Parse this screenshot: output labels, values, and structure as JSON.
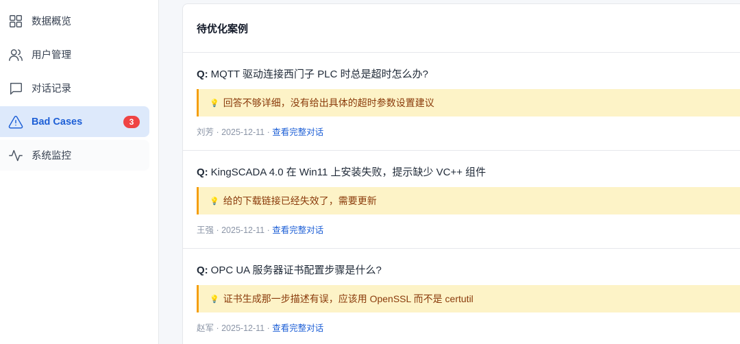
{
  "sidebar": {
    "items": [
      {
        "label": "数据概览",
        "icon": "grid-icon"
      },
      {
        "label": "用户管理",
        "icon": "users-icon"
      },
      {
        "label": "对话记录",
        "icon": "message-icon"
      },
      {
        "label": "Bad Cases",
        "icon": "alert-triangle-icon",
        "badge": "3",
        "active": true
      },
      {
        "label": "系统监控",
        "icon": "activity-icon"
      }
    ]
  },
  "main": {
    "card_title": "待优化案例",
    "cases": [
      {
        "q_prefix": "Q:",
        "question": "MQTT 驱动连接西门子 PLC 时总是超时怎么办?",
        "bulb": "💡",
        "note": "回答不够详细，没有给出具体的超时参数设置建议",
        "meta_prefix": "刘芳 · 2025-12-11 · ",
        "link": "查看完整对话"
      },
      {
        "q_prefix": "Q:",
        "question": "KingSCADA 4.0 在 Win11 上安装失败，提示缺少 VC++ 组件",
        "bulb": "💡",
        "note": "给的下载链接已经失效了，需要更新",
        "meta_prefix": "王强 · 2025-12-11 · ",
        "link": "查看完整对话"
      },
      {
        "q_prefix": "Q:",
        "question": "OPC UA 服务器证书配置步骤是什么?",
        "bulb": "💡",
        "note": "证书生成那一步描述有误，应该用 OpenSSL 而不是 certutil",
        "meta_prefix": "赵军 · 2025-12-11 · ",
        "link": "查看完整对话"
      }
    ]
  },
  "colors": {
    "accent": "#1d5fd6",
    "active_bg": "#dde9fb",
    "badge": "#ef4444",
    "note_bg": "#fdf3c7",
    "note_border": "#f59e0b",
    "note_text": "#8a3b0b"
  }
}
